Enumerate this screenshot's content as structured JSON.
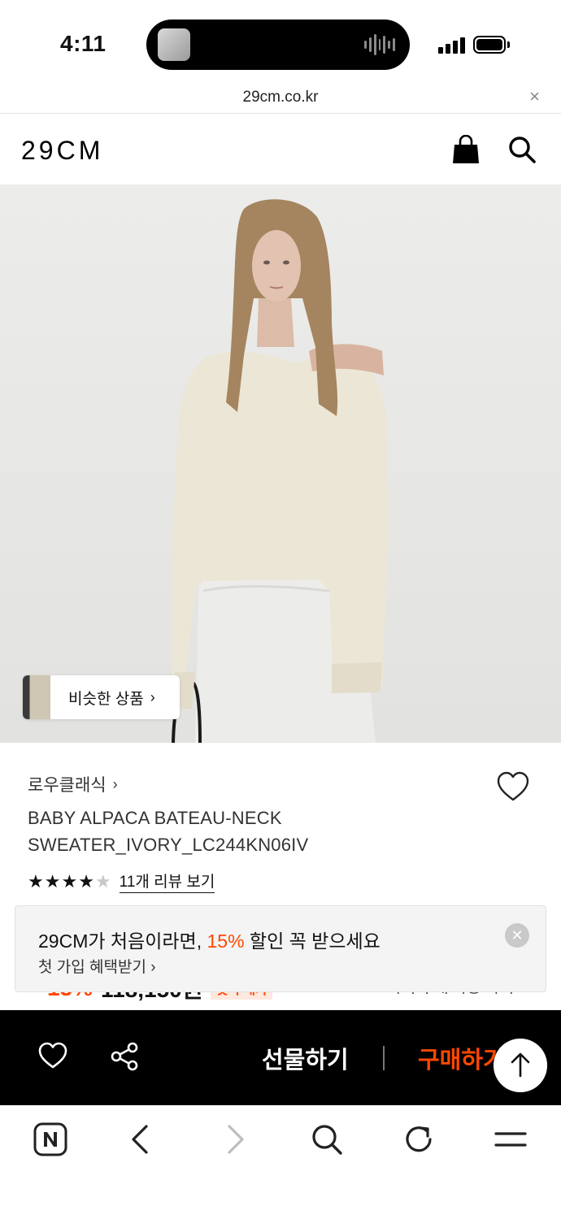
{
  "status_bar": {
    "time": "4:11"
  },
  "browser": {
    "url": "29cm.co.kr",
    "close_glyph": "×"
  },
  "header": {
    "logo": "29CM",
    "icons": [
      "shopping-bag-icon",
      "search-icon"
    ]
  },
  "hero": {
    "similar_label": "비슷한 상품",
    "similar_arrow": "›"
  },
  "product": {
    "brand": "로우클래식",
    "brand_arrow": "›",
    "title": "BABY ALPACA BATEAU-NECK SWEATER_IVORY_LC244KN06IV",
    "rating": 4,
    "rating_max": 5,
    "review_link": "11개 리뷰 보기"
  },
  "price_peek": {
    "percent": "15%",
    "price": "118,150원",
    "tag": "첫 구매가",
    "right_text": "나의 구매 가능 가격"
  },
  "signup_banner": {
    "headline_prefix": "29CM가 처음이라면, ",
    "headline_accent": "15%",
    "headline_suffix": " 할인 꼭 받으세요",
    "sub": "첫 가입 혜택받기 ›",
    "close_glyph": "✕"
  },
  "action_bar": {
    "gift_label": "선물하기",
    "buy_label": "구매하기"
  },
  "colors": {
    "accent": "#ff4800",
    "action_bar_bg": "#000000",
    "banner_bg": "#f4f4f4"
  }
}
